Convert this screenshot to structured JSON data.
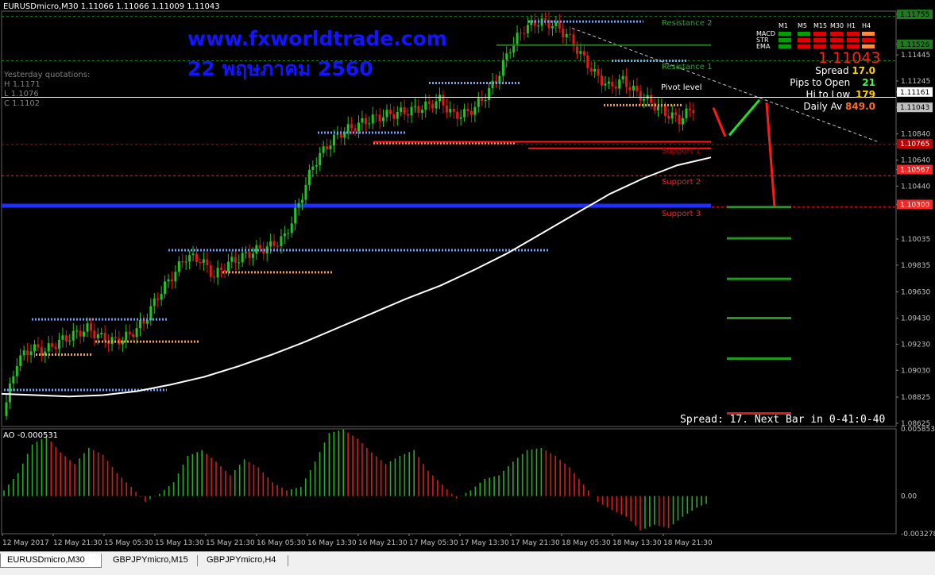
{
  "window": {
    "symbol_header": "EURUSDmicro,M30  1.11066 1.11066 1.11009 1.11043",
    "ao_header": "AO -0.000531"
  },
  "watermark": {
    "line1": "www.fxworldtrade.com",
    "line2": "22 พฤษภาคม  2560"
  },
  "yesterday": {
    "title": "Yesterday quotations:",
    "high": "H 1.1171",
    "low": "L 1.1076",
    "close": "C 1.1102"
  },
  "panel": {
    "tf_headers": [
      "M1",
      "M5",
      "M15",
      "M30",
      "H1",
      "H4"
    ],
    "rows": [
      "MACD",
      "STR",
      "EMA"
    ],
    "price": "1.11043",
    "spread_label": "Spread",
    "spread_value": "17.0",
    "pips_label": "Pips to Open",
    "pips_value": "21",
    "hilo_label": "Hi to Low",
    "hilo_value": "179",
    "daily_label": "Daily Av",
    "daily_value": "849.0",
    "colors": {
      "green": "#00a000",
      "red": "#e00000",
      "orange": "#ff8c40"
    }
  },
  "spread_bar": "Spread: 17. Next Bar in 0-41:0-40",
  "levels": [
    {
      "label": "Resistance 2",
      "price": 1.1174,
      "color": "#1f7a1f"
    },
    {
      "label": "Resistance 1",
      "price": 1.114,
      "color": "#1f7a1f"
    },
    {
      "label": "Pivot level",
      "price": 1.1112,
      "color": "#ffffff"
    },
    {
      "label": "Support 1",
      "price": 1.1076,
      "color": "#c00000"
    },
    {
      "label": "Support 2",
      "price": 1.1052,
      "color": "#ff2020"
    },
    {
      "label": "Support 3",
      "price": 1.1028,
      "color": "#ff2020"
    }
  ],
  "tabs": [
    "EURUSDmicro,M30",
    "GBPJPYmicro,M15",
    "GBPJPYmicro,H4"
  ],
  "chart_data": {
    "type": "candlestick",
    "price_axis": {
      "range": [
        1.086,
        1.1178
      ],
      "ticks": [
        "1.11755",
        "1.11526",
        "1.11445",
        "1.11245",
        "1.11161",
        "1.11043",
        "1.10840",
        "1.10765",
        "1.10640",
        "1.10567",
        "1.10440",
        "1.10300",
        "1.10035",
        "1.09835",
        "1.09630",
        "1.09430",
        "1.09230",
        "1.09030",
        "1.08825",
        "1.08625"
      ],
      "tick_values": [
        1.11755,
        1.11526,
        1.11445,
        1.11245,
        1.11161,
        1.11043,
        1.1084,
        1.10765,
        1.1064,
        1.10567,
        1.1044,
        1.103,
        1.10035,
        1.09835,
        1.0963,
        1.0943,
        1.0923,
        1.0903,
        1.08825,
        1.08625
      ]
    },
    "highlight_ticks": [
      {
        "text": "1.11755",
        "value": 1.11755,
        "bg": "#1f7a1f",
        "fg": "#000"
      },
      {
        "text": "1.11526",
        "value": 1.11526,
        "bg": "#1f7a1f",
        "fg": "#000"
      },
      {
        "text": "1.11161",
        "value": 1.11161,
        "bg": "#ffffff",
        "fg": "#000"
      },
      {
        "text": "1.11043",
        "value": 1.11043,
        "bg": "#c0c0c0",
        "fg": "#000"
      },
      {
        "text": "1.10765",
        "value": 1.10765,
        "bg": "#c00000",
        "fg": "#fff"
      },
      {
        "text": "1.10567",
        "value": 1.10567,
        "bg": "#ff2020",
        "fg": "#fff"
      },
      {
        "text": "1.10300",
        "value": 1.103,
        "bg": "#ff2020",
        "fg": "#fff"
      }
    ],
    "time_labels": [
      "12 May 2017",
      "12 May 21:30",
      "15 May 05:30",
      "15 May 13:30",
      "15 May 21:30",
      "16 May 05:30",
      "16 May 13:30",
      "16 May 21:30",
      "17 May 05:30",
      "17 May 13:30",
      "17 May 21:30",
      "18 May 05:30",
      "18 May 13:30",
      "18 May 21:30"
    ],
    "close_path": [
      1.0868,
      1.091,
      1.092,
      1.0918,
      1.0925,
      1.093,
      1.0935,
      1.0928,
      1.0925,
      1.093,
      1.094,
      1.096,
      1.0975,
      1.099,
      1.0988,
      1.0975,
      1.0985,
      1.099,
      1.0995,
      1.0998,
      1.1005,
      1.103,
      1.106,
      1.1075,
      1.1085,
      1.109,
      1.1095,
      1.1098,
      1.11,
      1.1102,
      1.1105,
      1.111,
      1.1098,
      1.11,
      1.111,
      1.1125,
      1.115,
      1.1165,
      1.117,
      1.1168,
      1.116,
      1.1145,
      1.113,
      1.112,
      1.1125,
      1.1115,
      1.1108,
      1.11,
      1.1095,
      1.1104
    ],
    "ma_series": [
      1.0885,
      1.0884,
      1.0883,
      1.0884,
      1.0887,
      1.0892,
      1.0898,
      1.0906,
      1.0915,
      1.0925,
      1.0936,
      1.0947,
      1.0958,
      1.0968,
      1.098,
      1.0993,
      1.1008,
      1.1023,
      1.1038,
      1.105,
      1.106,
      1.1066
    ],
    "ao": {
      "range": [
        -0.003278,
        0.005853
      ],
      "ticks": [
        "0.005853",
        "0.00",
        "-0.003278"
      ],
      "tick_values": [
        0.005853,
        0.0,
        -0.003278
      ],
      "values": [
        0.0005,
        0.002,
        0.0045,
        0.0052,
        0.0038,
        0.0028,
        0.0042,
        0.0036,
        0.002,
        0.0008,
        -0.0005,
        0.0002,
        0.0012,
        0.0035,
        0.004,
        0.003,
        0.0018,
        0.0032,
        0.0025,
        0.0012,
        0.0005,
        0.0008,
        0.003,
        0.0055,
        0.0058,
        0.005,
        0.0038,
        0.0028,
        0.0035,
        0.004,
        0.0022,
        0.001,
        -0.0002,
        0.0005,
        0.0015,
        0.0018,
        0.003,
        0.004,
        0.0042,
        0.0035,
        0.0025,
        0.001,
        -0.0005,
        -0.0012,
        -0.0018,
        -0.003,
        -0.0025,
        -0.0028,
        -0.0018,
        -0.001,
        -0.0005
      ]
    }
  }
}
